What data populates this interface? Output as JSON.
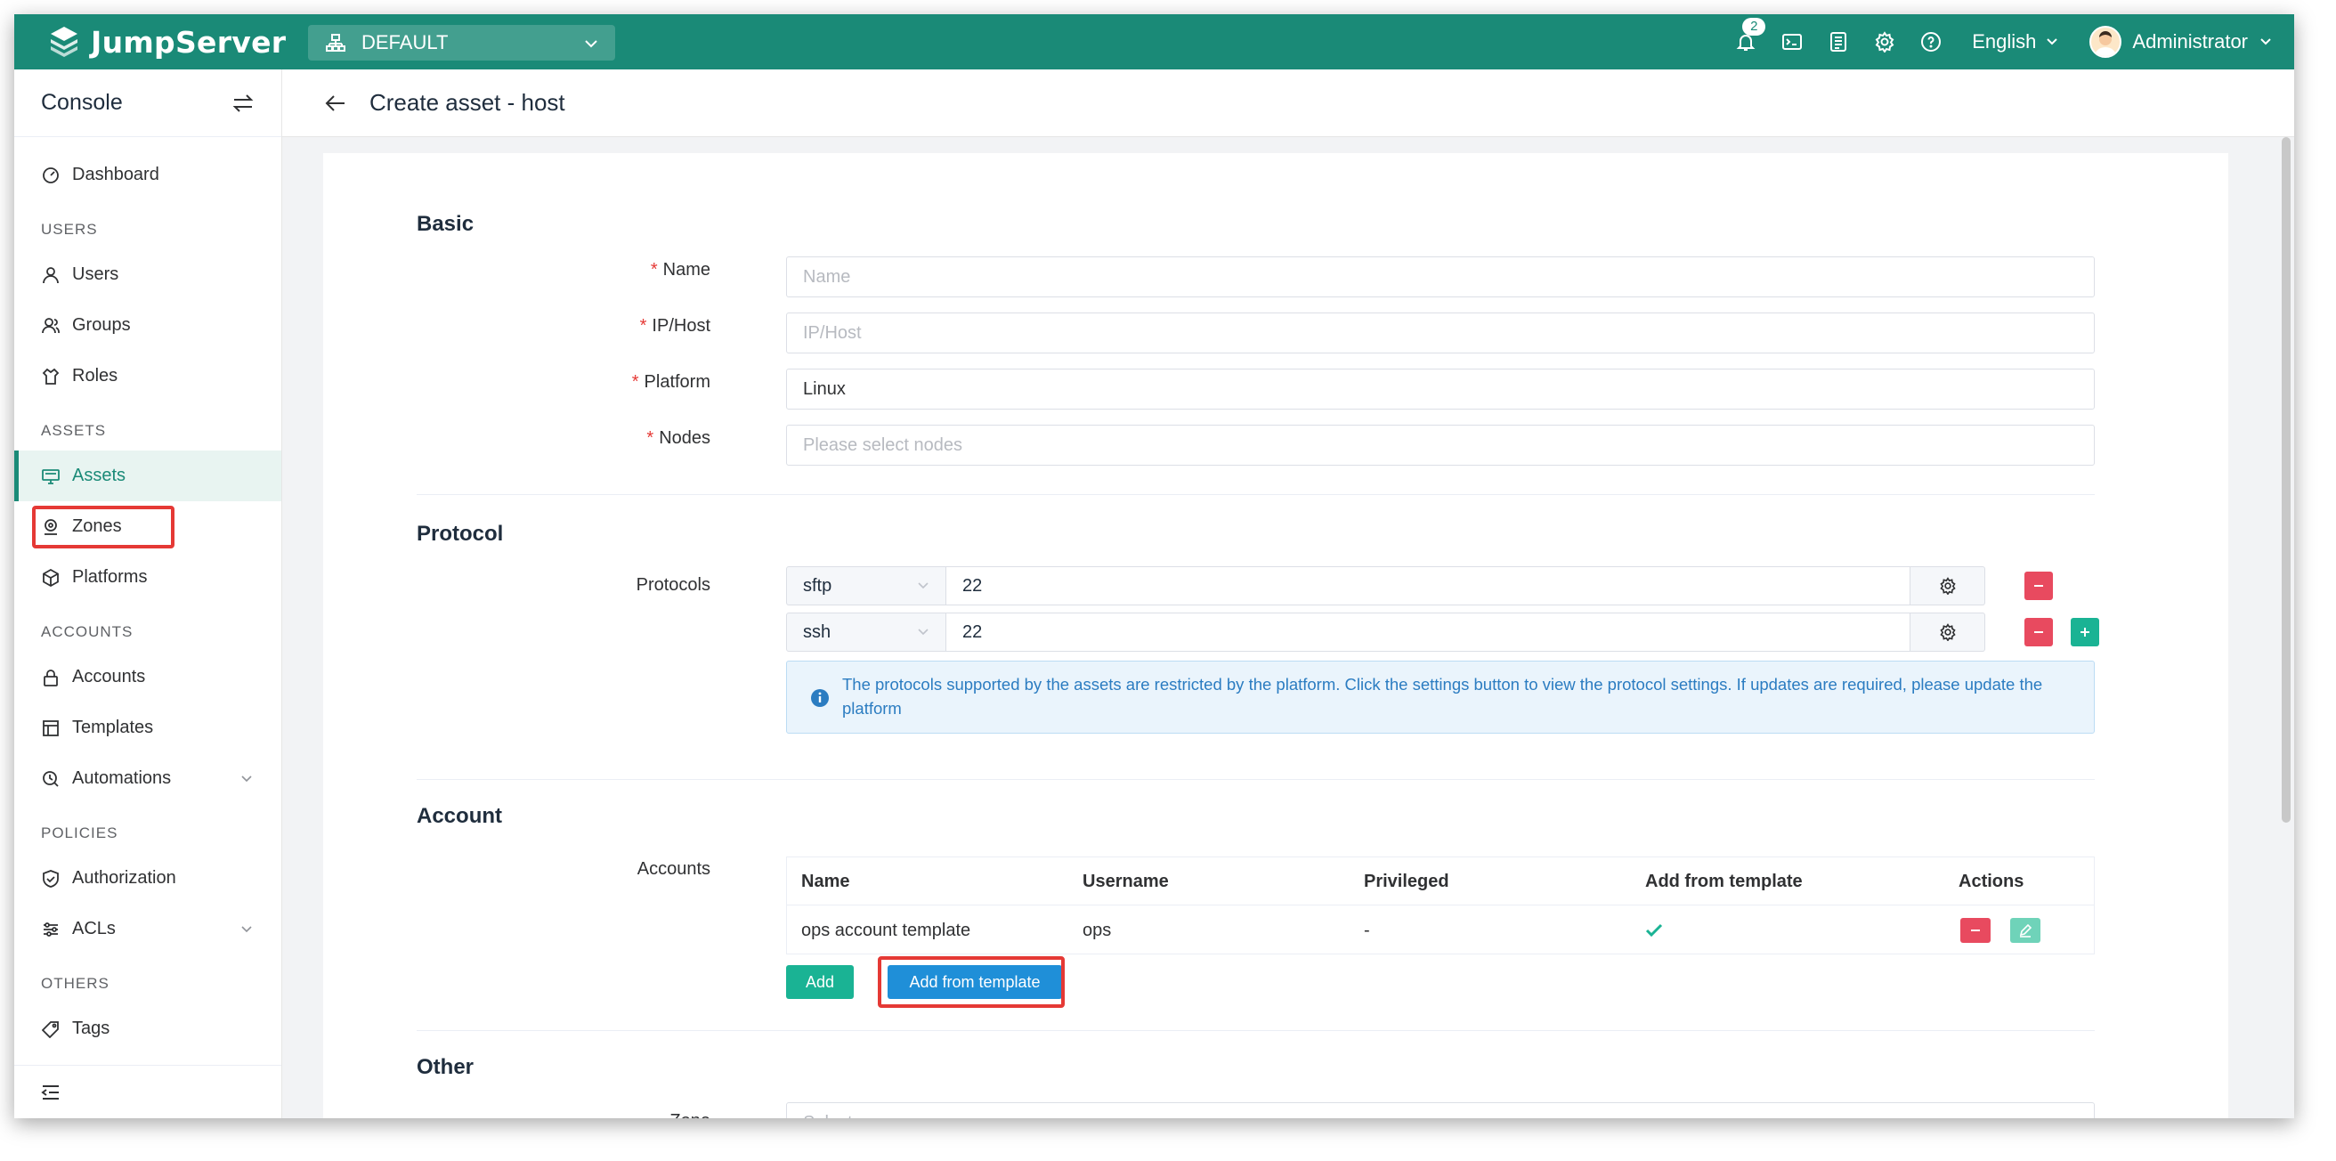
{
  "app": {
    "name": "JumpServer",
    "org": "DEFAULT",
    "language": "English",
    "user": "Administrator",
    "notification_count": "2",
    "brand_color": "#1a8a77"
  },
  "sidebar": {
    "title": "Console",
    "items": [
      {
        "type": "item",
        "label": "Dashboard",
        "icon": "dashboard-icon"
      },
      {
        "type": "group",
        "label": "USERS"
      },
      {
        "type": "item",
        "label": "Users",
        "icon": "user-icon"
      },
      {
        "type": "item",
        "label": "Groups",
        "icon": "group-icon"
      },
      {
        "type": "item",
        "label": "Roles",
        "icon": "role-icon"
      },
      {
        "type": "group",
        "label": "ASSETS"
      },
      {
        "type": "item",
        "label": "Assets",
        "icon": "monitor-icon",
        "active": true
      },
      {
        "type": "item",
        "label": "Zones",
        "icon": "location-icon"
      },
      {
        "type": "item",
        "label": "Platforms",
        "icon": "cube-icon"
      },
      {
        "type": "group",
        "label": "ACCOUNTS"
      },
      {
        "type": "item",
        "label": "Accounts",
        "icon": "lock-icon"
      },
      {
        "type": "item",
        "label": "Templates",
        "icon": "template-icon"
      },
      {
        "type": "item",
        "label": "Automations",
        "icon": "automation-icon",
        "expandable": true
      },
      {
        "type": "group",
        "label": "POLICIES"
      },
      {
        "type": "item",
        "label": "Authorization",
        "icon": "shield-icon"
      },
      {
        "type": "item",
        "label": "ACLs",
        "icon": "acl-icon",
        "expandable": true
      },
      {
        "type": "group",
        "label": "OTHERS"
      },
      {
        "type": "item",
        "label": "Tags",
        "icon": "tag-icon"
      }
    ]
  },
  "page": {
    "title": "Create asset - host"
  },
  "form": {
    "basic": {
      "title": "Basic",
      "name_label": "Name",
      "name_placeholder": "Name",
      "ip_label": "IP/Host",
      "ip_placeholder": "IP/Host",
      "platform_label": "Platform",
      "platform_value": "Linux",
      "nodes_label": "Nodes",
      "nodes_placeholder": "Please select nodes"
    },
    "protocol": {
      "title": "Protocol",
      "label": "Protocols",
      "rows": [
        {
          "name": "sftp",
          "port": "22"
        },
        {
          "name": "ssh",
          "port": "22"
        }
      ],
      "info": "The protocols supported by the assets are restricted by the platform. Click the settings button to view the protocol settings. If updates are required, please update the platform"
    },
    "account": {
      "title": "Account",
      "label": "Accounts",
      "columns": [
        "Name",
        "Username",
        "Privileged",
        "Add from template",
        "Actions"
      ],
      "rows": [
        {
          "name": "ops account template",
          "username": "ops",
          "privileged": "-"
        }
      ],
      "add_button": "Add",
      "add_template_button": "Add from template"
    },
    "other": {
      "title": "Other",
      "zone_label": "Zone",
      "zone_placeholder": "Select"
    }
  }
}
